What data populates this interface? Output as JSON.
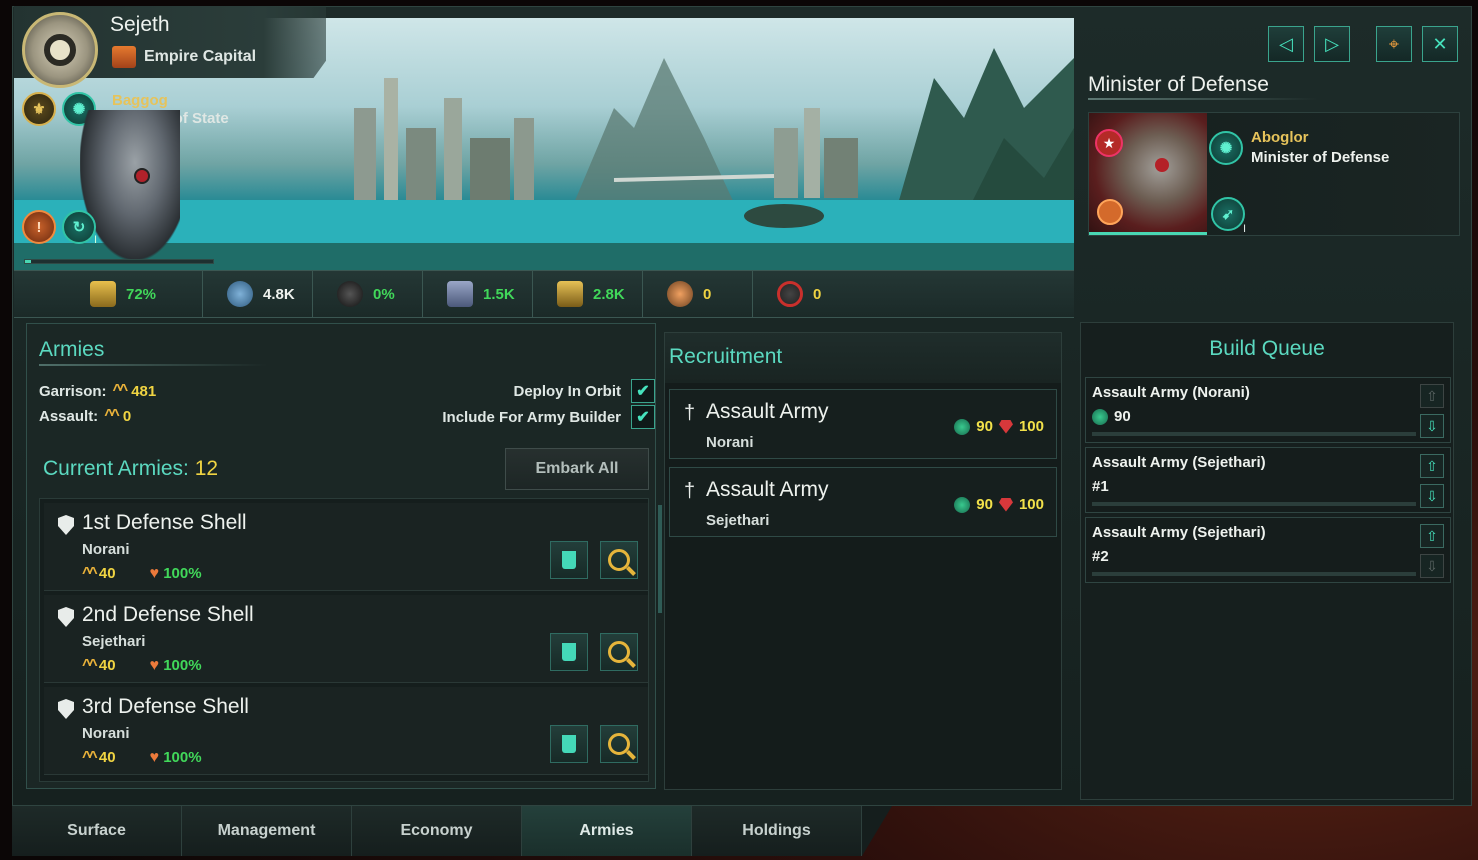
{
  "planet": {
    "name": "Sejeth",
    "designation": "Empire Capital"
  },
  "governor": {
    "name": "Baggog",
    "title": "Minister of State",
    "level": "I"
  },
  "stats": [
    {
      "icon": "stability-icon",
      "value": "72%",
      "color": "green"
    },
    {
      "icon": "population-icon",
      "value": "4.8K",
      "color": "white"
    },
    {
      "icon": "crime-icon",
      "value": "0%",
      "color": "green"
    },
    {
      "icon": "amenities-icon",
      "value": "1.5K",
      "color": "green"
    },
    {
      "icon": "housing-icon",
      "value": "2.8K",
      "color": "green"
    },
    {
      "icon": "free-jobs-icon",
      "value": "0",
      "color": "yellow"
    },
    {
      "icon": "blocked-icon",
      "value": "0",
      "color": "yellow"
    }
  ],
  "minister": {
    "section_label": "Minister of Defense",
    "name": "Aboglor",
    "title": "Minister of Defense",
    "level": "I"
  },
  "armies": {
    "heading": "Armies",
    "garrison_label": "Garrison:",
    "garrison_value": "481",
    "assault_label": "Assault:",
    "assault_value": "0",
    "deploy_label": "Deploy In Orbit",
    "include_label": "Include For Army Builder",
    "current_label": "Current Armies:",
    "current_count": "12",
    "embark_label": "Embark All",
    "list": [
      {
        "name": "1st Defense Shell",
        "species": "Norani",
        "strength": "40",
        "health": "100%"
      },
      {
        "name": "2nd Defense Shell",
        "species": "Sejethari",
        "strength": "40",
        "health": "100%"
      },
      {
        "name": "3rd Defense Shell",
        "species": "Norani",
        "strength": "40",
        "health": "100%"
      }
    ]
  },
  "recruitment": {
    "heading": "Recruitment",
    "items": [
      {
        "name": "Assault Army",
        "species": "Norani",
        "cost_a": "90",
        "cost_b": "100"
      },
      {
        "name": "Assault Army",
        "species": "Sejethari",
        "cost_a": "90",
        "cost_b": "100"
      }
    ]
  },
  "queue": {
    "heading": "Build Queue",
    "items": [
      {
        "name": "Assault Army (Norani)",
        "sub": "90"
      },
      {
        "name": "Assault Army (Sejethari)",
        "sub": "#1"
      },
      {
        "name": "Assault Army (Sejethari)",
        "sub": "#2"
      }
    ]
  },
  "tabs": [
    "Surface",
    "Management",
    "Economy",
    "Armies",
    "Holdings"
  ],
  "active_tab": "Armies",
  "colors": {
    "accent": "#5bd9c0",
    "gold": "#f0d442",
    "positive": "#41d85a"
  }
}
